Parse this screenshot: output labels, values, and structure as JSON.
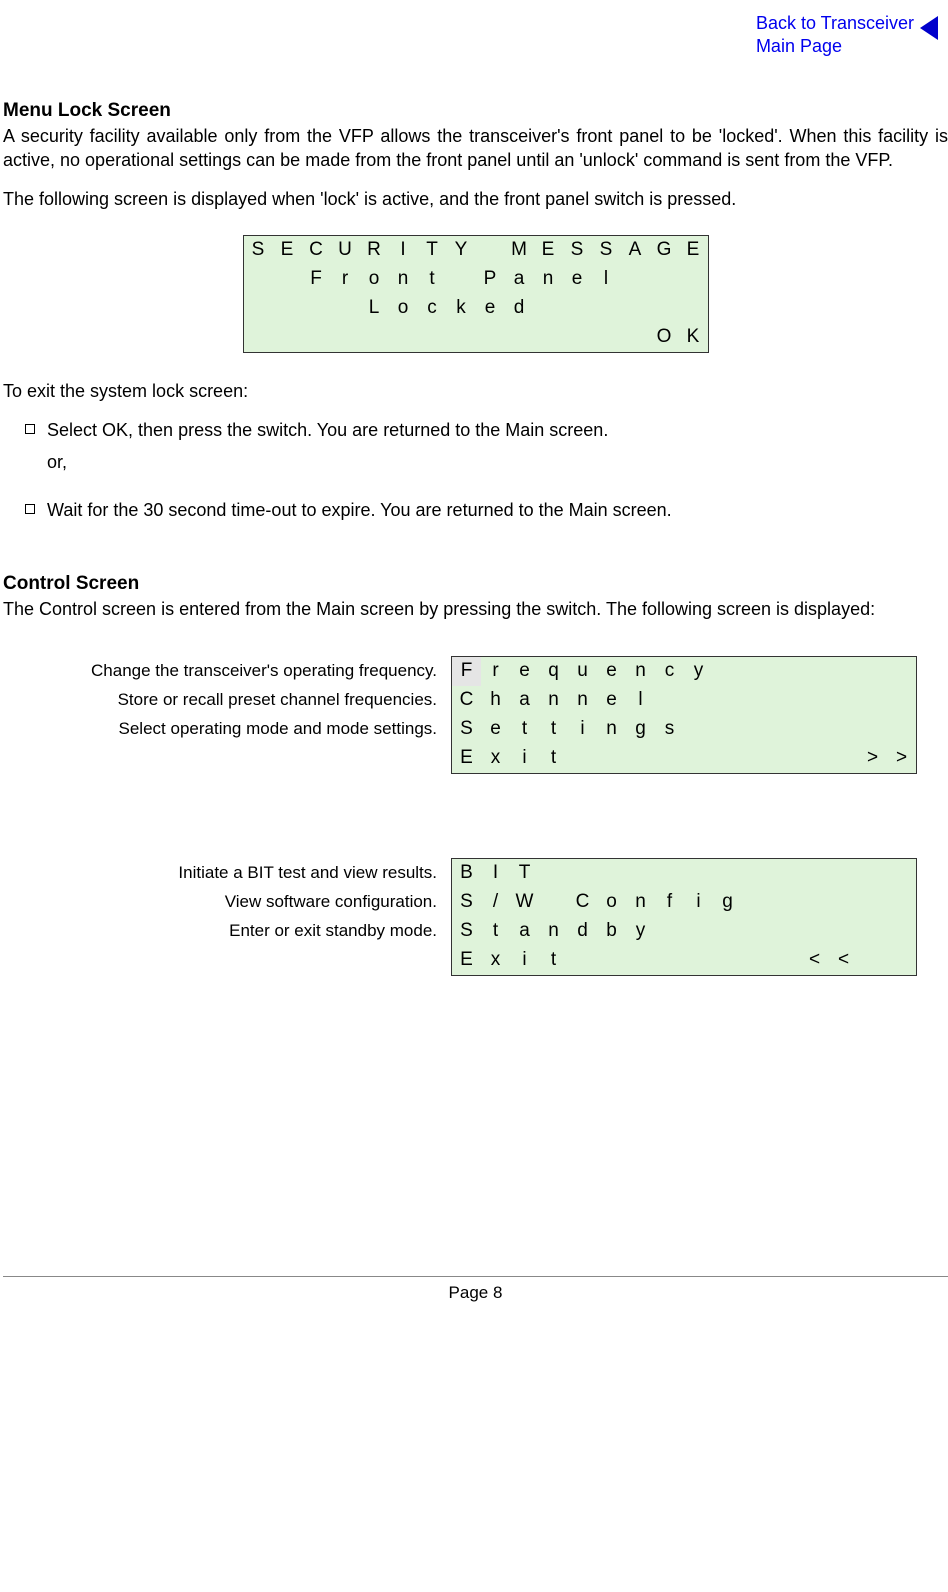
{
  "nav": {
    "back_line1": "Back to Transceiver",
    "back_line2": "Main Page"
  },
  "section1": {
    "heading": "Menu Lock Screen",
    "p1": "A security facility available only from the VFP allows the transceiver's front panel to be 'locked'. When this facility is active, no operational settings can be made from the front panel until an 'unlock' command is sent from the VFP.",
    "p2": "The following screen is displayed when 'lock' is active, and the front panel switch is pressed.",
    "exit_intro": "To exit the system lock screen:",
    "bullet1": "Select OK, then press the switch. You are returned to the Main screen.",
    "or": "or,",
    "bullet2": "Wait for the 30 second time-out to expire. You are returned to the Main screen."
  },
  "lcd_lock": {
    "cols": 16,
    "rows": [
      {
        "cells": [
          "S",
          "E",
          "C",
          "U",
          "R",
          "I",
          "T",
          "Y",
          "",
          "M",
          "E",
          "S",
          "S",
          "A",
          "G",
          "E"
        ]
      },
      {
        "cells": [
          "",
          "",
          "F",
          "r",
          "o",
          "n",
          "t",
          "",
          "P",
          "a",
          "n",
          "e",
          "l",
          "",
          "",
          ""
        ]
      },
      {
        "cells": [
          "",
          "",
          "",
          "",
          "L",
          "o",
          "c",
          "k",
          "e",
          "d",
          "",
          "",
          "",
          "",
          "",
          ""
        ]
      },
      {
        "cells": [
          "",
          "",
          "",
          "",
          "",
          "",
          "",
          "",
          "",
          "",
          "",
          "",
          "",
          "",
          "O",
          "K"
        ]
      }
    ]
  },
  "section2": {
    "heading": "Control Screen",
    "p1": "The Control screen is entered from the Main screen by pressing the switch. The following screen is displayed:"
  },
  "menuA": {
    "desc": [
      "Change the transceiver's operating frequency.",
      "Store or recall preset channel frequencies.",
      "Select operating mode and mode settings."
    ],
    "lcd": {
      "cols": 16,
      "rows": [
        {
          "cells": [
            "F",
            "r",
            "e",
            "q",
            "u",
            "e",
            "n",
            "c",
            "y",
            "",
            "",
            "",
            "",
            "",
            "",
            ""
          ],
          "highlight": 0
        },
        {
          "cells": [
            "C",
            "h",
            "a",
            "n",
            "n",
            "e",
            "l",
            "",
            "",
            "",
            "",
            "",
            "",
            "",
            "",
            ""
          ]
        },
        {
          "cells": [
            "S",
            "e",
            "t",
            "t",
            "i",
            "n",
            "g",
            "s",
            "",
            "",
            "",
            "",
            "",
            "",
            "",
            ""
          ]
        },
        {
          "cells": [
            "E",
            "x",
            "i",
            "t",
            "",
            "",
            "",
            "",
            "",
            "",
            "",
            "",
            "",
            "",
            ">",
            ">"
          ]
        }
      ]
    }
  },
  "menuB": {
    "desc": [
      "Initiate a BIT test and view results.",
      "View software configuration.",
      "Enter or exit standby mode."
    ],
    "lcd": {
      "cols": 16,
      "rows": [
        {
          "cells": [
            "B",
            "I",
            "T",
            "",
            "",
            "",
            "",
            "",
            "",
            "",
            "",
            "",
            "",
            "",
            "",
            ""
          ]
        },
        {
          "cells": [
            "S",
            "/",
            "W",
            "",
            "C",
            "o",
            "n",
            "f",
            "i",
            "g",
            "",
            "",
            "",
            "",
            "",
            ""
          ]
        },
        {
          "cells": [
            "S",
            "t",
            "a",
            "n",
            "d",
            "b",
            "y",
            "",
            "",
            "",
            "",
            "",
            "",
            "",
            "",
            ""
          ]
        },
        {
          "cells": [
            "E",
            "x",
            "i",
            "t",
            "",
            "",
            "",
            "",
            "",
            "",
            "",
            "",
            "<",
            "<",
            "",
            ""
          ]
        }
      ]
    }
  },
  "footer": {
    "page": "Page 8"
  }
}
